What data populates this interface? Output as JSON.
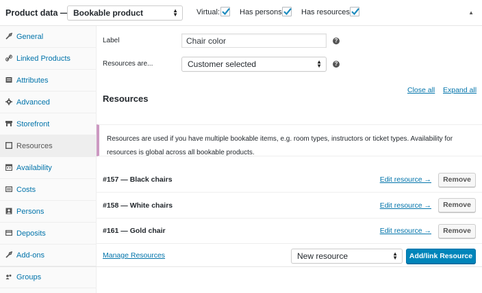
{
  "header": {
    "title": "Product data —",
    "product_type": "Bookable product",
    "checks": [
      {
        "label": "Virtual:",
        "checked": true
      },
      {
        "label": "Has persons:",
        "checked": true
      },
      {
        "label": "Has resources:",
        "checked": true
      }
    ],
    "collapse_icon": "triangle-up-icon"
  },
  "sidebar": {
    "items": [
      {
        "label": "General",
        "icon": "wrench-icon"
      },
      {
        "label": "Linked Products",
        "icon": "link-icon"
      },
      {
        "label": "Attributes",
        "icon": "list-icon"
      },
      {
        "label": "Advanced",
        "icon": "gear-icon"
      },
      {
        "label": "Storefront",
        "icon": "storefront-icon"
      },
      {
        "label": "Resources",
        "icon": "resources-icon",
        "active": true
      },
      {
        "label": "Availability",
        "icon": "calendar-icon"
      },
      {
        "label": "Costs",
        "icon": "costs-icon"
      },
      {
        "label": "Persons",
        "icon": "persons-icon"
      },
      {
        "label": "Deposits",
        "icon": "deposits-icon"
      },
      {
        "label": "Add-ons",
        "icon": "wrench-icon"
      },
      {
        "label": "Groups",
        "icon": "groups-icon"
      }
    ]
  },
  "form": {
    "label_field": {
      "label": "Label",
      "value": "Chair color"
    },
    "resources_are": {
      "label": "Resources are...",
      "value": "Customer selected"
    }
  },
  "resources": {
    "title": "Resources",
    "close_all": "Close all",
    "expand_all": "Expand all",
    "notice": "Resources are used if you have multiple bookable items, e.g. room types, instructors or ticket types. Availability for resources is global across all bookable products.",
    "rows": [
      {
        "name": "#157 — Black chairs",
        "edit": "Edit resource →",
        "remove": "Remove"
      },
      {
        "name": "#158 — White chairs",
        "edit": "Edit resource →",
        "remove": "Remove"
      },
      {
        "name": "#161 — Gold chair",
        "edit": "Edit resource →",
        "remove": "Remove"
      }
    ],
    "manage_link": "Manage Resources",
    "new_resource_select": "New resource",
    "add_button": "Add/link Resource"
  },
  "colors": {
    "link": "#0073aa",
    "primary_button": "#0085ba",
    "notice_border": "#cc99c2"
  }
}
